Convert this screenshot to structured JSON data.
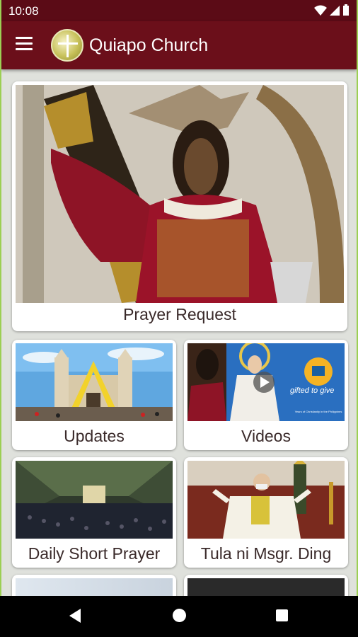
{
  "status": {
    "time": "10:08"
  },
  "app": {
    "title": "Quiapo Church"
  },
  "cards": {
    "prayer_request": "Prayer Request",
    "updates": "Updates",
    "videos": "Videos",
    "daily_short_prayer": "Daily Short Prayer",
    "tula": "Tula ni Msgr. Ding"
  },
  "videos_overlay": {
    "tagline": "gifted to give",
    "subtitle": "Years of Christianity in the Philippines"
  },
  "colors": {
    "app_bar": "#6b0f1a",
    "status_bar": "#5b0b16",
    "background": "#dfe1dc",
    "accent_border": "#9ccf54"
  }
}
